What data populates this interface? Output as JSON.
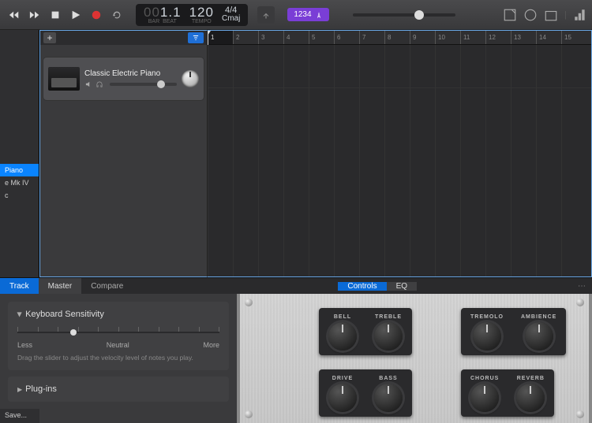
{
  "toolbar": {
    "lcd": {
      "dim_pre": "00",
      "bars": "1",
      "beats": "1",
      "bars_lbl": "BAR",
      "beats_lbl": "BEAT",
      "tempo": "120",
      "tempo_lbl": "TEMPO",
      "sig": "4/4",
      "key": "Cmaj"
    },
    "purple": "1234"
  },
  "library": {
    "items": [
      {
        "label": "Piano",
        "selected": true
      },
      {
        "label": "e Mk IV",
        "selected": false
      },
      {
        "label": "c",
        "selected": false
      }
    ],
    "save_label": "Save..."
  },
  "tracks": {
    "track1": {
      "name": "Classic Electric Piano"
    }
  },
  "ruler": {
    "bars": [
      1,
      2,
      3,
      4,
      5,
      6,
      7,
      8,
      9,
      10,
      11,
      12,
      13,
      14,
      15
    ]
  },
  "editor": {
    "tabs": {
      "track": "Track",
      "master": "Master",
      "compare": "Compare",
      "controls": "Controls",
      "eq": "EQ"
    },
    "sensitivity": {
      "title": "Keyboard Sensitivity",
      "less": "Less",
      "neutral": "Neutral",
      "more": "More",
      "help": "Drag the slider to adjust the velocity level of notes you play."
    },
    "plugins": "Plug-ins",
    "knobs": {
      "bell": "BELL",
      "treble": "TREBLE",
      "tremolo": "TREMOLO",
      "ambience": "AMBIENCE",
      "drive": "DRIVE",
      "bass": "BASS",
      "chorus": "CHORUS",
      "reverb": "REVERB"
    }
  }
}
